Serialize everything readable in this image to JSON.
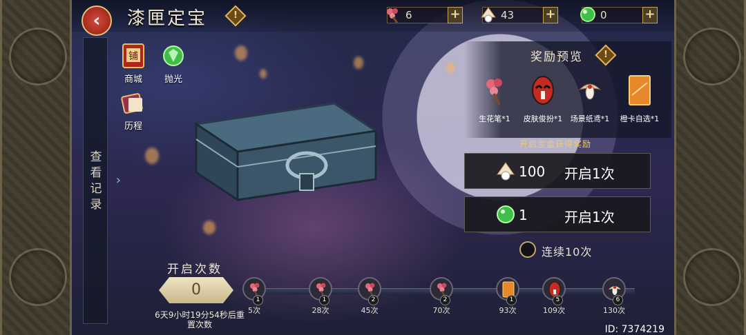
{
  "header": {
    "title": "漆匣定宝",
    "info_symbol": "!"
  },
  "currencies": [
    {
      "icon": "flower-brush-icon",
      "value": "6",
      "color": "#d65a6a"
    },
    {
      "icon": "fan-icon",
      "value": "43",
      "color": "#e7c08a"
    },
    {
      "icon": "jade-orb-icon",
      "value": "0",
      "color": "#3fbf4a"
    }
  ],
  "history_tab": {
    "label": "查看记录"
  },
  "shortcuts": [
    {
      "name": "shop",
      "label": "商城",
      "icon": "shop-sign-icon"
    },
    {
      "name": "polish",
      "label": "抛光",
      "icon": "jade-orb-icon"
    },
    {
      "name": "history",
      "label": "历程",
      "icon": "scroll-icon"
    }
  ],
  "reward_preview": {
    "title": "奖励预览",
    "items": [
      {
        "label": "生花笔*1",
        "icon": "flower-brush-icon",
        "color": "#d65a6a"
      },
      {
        "label": "皮肤俊扮*1",
        "icon": "opera-mask-icon",
        "color": "#c42b22"
      },
      {
        "label": "场景纸鸢*1",
        "icon": "kite-icon",
        "color": "#e0c2a0"
      },
      {
        "label": "橙卡自选*1",
        "icon": "orange-card-icon",
        "color": "#e7892a"
      }
    ]
  },
  "open_caption": "开启宝盒获得奖励",
  "open_buttons": [
    {
      "cost": "100",
      "label": "开启1次",
      "icon": "fan-icon"
    },
    {
      "cost": "1",
      "label": "开启1次",
      "icon": "jade-orb-icon"
    }
  ],
  "continuous_toggle": {
    "label": "连续10次",
    "checked": false
  },
  "open_count": {
    "title": "开启次数",
    "value": "0",
    "reset_note": "6天9小时19分54秒后重置次数"
  },
  "milestones": [
    {
      "label": "5次",
      "qty": "1",
      "icon": "flower-brush-icon"
    },
    {
      "label": "28次",
      "qty": "1",
      "icon": "flower-brush-icon"
    },
    {
      "label": "45次",
      "qty": "2",
      "icon": "flower-brush-icon"
    },
    {
      "label": "70次",
      "qty": "2",
      "icon": "flower-brush-icon"
    },
    {
      "label": "93次",
      "qty": "1",
      "icon": "orange-card-icon"
    },
    {
      "label": "109次",
      "qty": "5",
      "icon": "opera-mask-icon"
    },
    {
      "label": "130次",
      "qty": "6",
      "icon": "kite-icon"
    }
  ],
  "player": {
    "id": "ID: 7374219"
  }
}
